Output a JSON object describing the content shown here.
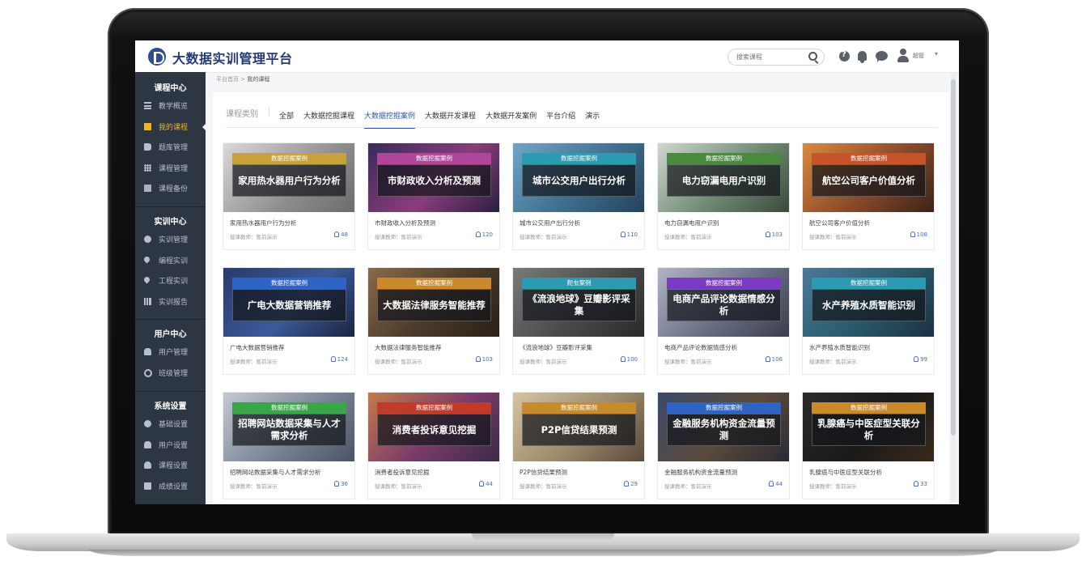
{
  "header": {
    "app_title": "大数据实训管理平台",
    "search_placeholder": "搜索课程",
    "user_name": "超管",
    "caret": "▾"
  },
  "icons": {
    "logo": "logo-icon",
    "search": "search-icon",
    "help": "help-icon",
    "bell": "bell-icon",
    "chat": "chat-icon",
    "avatar": "user-avatar-icon"
  },
  "sidebar": {
    "groups": [
      {
        "title": "课程中心",
        "items": [
          {
            "label": "教学概览",
            "icon": "list-icon"
          },
          {
            "label": "我的课程",
            "icon": "list-icon",
            "active": true
          },
          {
            "label": "题库管理",
            "icon": "book-icon"
          },
          {
            "label": "课程管理",
            "icon": "grid-icon"
          },
          {
            "label": "课程备份",
            "icon": "table-icon"
          }
        ]
      },
      {
        "title": "实训中心",
        "items": [
          {
            "label": "实训管理",
            "icon": "cog-icon"
          },
          {
            "label": "编程实训",
            "icon": "pin-icon"
          },
          {
            "label": "工程实训",
            "icon": "pin-icon"
          },
          {
            "label": "实训报告",
            "icon": "bar-chart-icon"
          }
        ]
      },
      {
        "title": "用户中心",
        "items": [
          {
            "label": "用户管理",
            "icon": "users-icon"
          },
          {
            "label": "班级管理",
            "icon": "circle-icon"
          }
        ]
      },
      {
        "title": "系统设置",
        "items": [
          {
            "label": "基础设置",
            "icon": "cog-icon"
          },
          {
            "label": "用户设置",
            "icon": "user-icon"
          },
          {
            "label": "课程设置",
            "icon": "cloud-icon"
          },
          {
            "label": "成绩设置",
            "icon": "print-icon"
          }
        ]
      }
    ]
  },
  "breadcrumb": {
    "home": "平台首页",
    "separator": ">",
    "current": "我的课程"
  },
  "category": {
    "label": "课程类别",
    "tabs": [
      {
        "label": "全部"
      },
      {
        "label": "大数据挖掘课程"
      },
      {
        "label": "大数据挖掘案例",
        "active": true
      },
      {
        "label": "大数据开发课程"
      },
      {
        "label": "大数据开发案例"
      },
      {
        "label": "平台介绍"
      },
      {
        "label": "演示"
      }
    ]
  },
  "teacher_prefix": "授课教师：",
  "teacher_name": "售前演示",
  "colors": {
    "accent": "#3356a6",
    "sidebar_bg": "#2d3643",
    "sidebar_active": "#f0b323"
  },
  "courses": [
    {
      "tag": "数据挖掘案例",
      "tag_color": "#c8a13a",
      "banner": "家用热水器用户行为分析",
      "title": "家用热水器用户行为分析",
      "teacher": "授课教师：售前演示",
      "count": "48",
      "bg": "linear-gradient(135deg,#d9d9d9,#8e8e8e 60%,#6b6b6b)"
    },
    {
      "tag": "数据挖掘案例",
      "tag_color": "#b0469b",
      "banner": "市财政收入分析及预测",
      "title": "市财政收入分析及预测",
      "teacher": "授课教师：售前演示",
      "count": "120",
      "bg": "linear-gradient(135deg,#3a2a5a,#8a3d7a 55%,#2a1f3f)"
    },
    {
      "tag": "数据挖掘案例",
      "tag_color": "#2a9bb0",
      "banner": "城市公交用户出行分析",
      "title": "城市公交用户出行分析",
      "teacher": "授课教师：售前演示",
      "count": "110",
      "bg": "linear-gradient(135deg,#6fa6c6,#3f6f8e 55%,#24425a)"
    },
    {
      "tag": "数据挖掘案例",
      "tag_color": "#4a8a3e",
      "banner": "电力窃漏电用户识别",
      "title": "电力窃漏电用户识别",
      "teacher": "授课教师：售前演示",
      "count": "103",
      "bg": "linear-gradient(135deg,#cfd7cf,#6f8a73 55%,#3a4a3c)"
    },
    {
      "tag": "数据挖掘案例",
      "tag_color": "#c4542a",
      "banner": "航空公司客户价值分析",
      "title": "航空公司客户价值分析",
      "teacher": "授课教师：售前演示",
      "count": "108",
      "bg": "linear-gradient(135deg,#d98a3e,#8a4a2a 55%,#3a2418)"
    },
    {
      "tag": "数据挖掘案例",
      "tag_color": "#2f63c4",
      "banner": "广电大数据营销推荐",
      "title": "广电大数据营销推荐",
      "teacher": "授课教师：售前演示",
      "count": "124",
      "bg": "linear-gradient(135deg,#2a3a6a,#3a5a9a 55%,#1a2440)"
    },
    {
      "tag": "数据挖掘案例",
      "tag_color": "#c88a2a",
      "banner": "大数据法律服务智能推荐",
      "title": "大数据法律服务智能推荐",
      "teacher": "授课教师：售前演示",
      "count": "103",
      "bg": "linear-gradient(135deg,#8a6a4a,#4a3a2a 55%,#2a2018)"
    },
    {
      "tag": "爬虫案例",
      "tag_color": "#2a9bb0",
      "banner": "《流浪地球》豆瓣影评采集",
      "title": "《流浪地球》豆瓣影评采集",
      "teacher": "授课教师：售前演示",
      "count": "100",
      "bg": "linear-gradient(135deg,#7a7a7a,#4a4a4a 55%,#2a2a2a)"
    },
    {
      "tag": "数据挖掘案例",
      "tag_color": "#7a3ac4",
      "banner": "电商产品评论数据情感分析",
      "title": "电商产品评论数据情感分析",
      "teacher": "授课教师：售前演示",
      "count": "106",
      "bg": "linear-gradient(135deg,#b0b4c4,#6a6e84 55%,#3a3e4e)"
    },
    {
      "tag": "数据挖掘案例",
      "tag_color": "#2a9bb0",
      "banner": "水产养殖水质智能识别",
      "title": "水产养殖水质智能识别",
      "teacher": "授课教师：售前演示",
      "count": "99",
      "bg": "linear-gradient(135deg,#4a7a9a,#2a5a6a 55%,#1a3040)"
    },
    {
      "tag": "数据挖掘案例",
      "tag_color": "#3aa64a",
      "banner": "招聘网站数据采集与人才需求分析",
      "title": "招聘网站数据采集与人才需求分析",
      "teacher": "授课教师：售前演示",
      "count": "36",
      "bg": "linear-gradient(135deg,#c4cad4,#7a8494 55%,#4a5464)"
    },
    {
      "tag": "数据挖掘案例",
      "tag_color": "#c43a2a",
      "banner": "消费者投诉意见挖掘",
      "title": "消费者投诉意见挖掘",
      "teacher": "授课教师：售前演示",
      "count": "44",
      "bg": "linear-gradient(135deg,#c47a4a,#7a3a6a 55%,#3a2a4a)"
    },
    {
      "tag": "数据挖掘案例",
      "tag_color": "#c88a2a",
      "banner": "P2P信贷结果预测",
      "title": "P2P信贷结果预测",
      "teacher": "授课教师：售前演示",
      "count": "29",
      "bg": "linear-gradient(135deg,#d4c4a4,#9a8a6a 55%,#5a4a3a)"
    },
    {
      "tag": "数据挖掘案例",
      "tag_color": "#2f63c4",
      "banner": "金融服务机构资金流量预测",
      "title": "金融服务机构资金流量预测",
      "teacher": "授课教师：售前演示",
      "count": "44",
      "bg": "linear-gradient(135deg,#3a4a6a,#5a4a3a 55%,#2a2a34)"
    },
    {
      "tag": "数据挖掘案例",
      "tag_color": "#c88a2a",
      "banner": "乳腺癌与中医症型关联分析",
      "title": "乳腺癌与中医症型关联分析",
      "teacher": "授课教师：售前演示",
      "count": "33",
      "bg": "linear-gradient(135deg,#2a2a2a,#1a1a1a 55%,#3a2a1a)"
    }
  ]
}
